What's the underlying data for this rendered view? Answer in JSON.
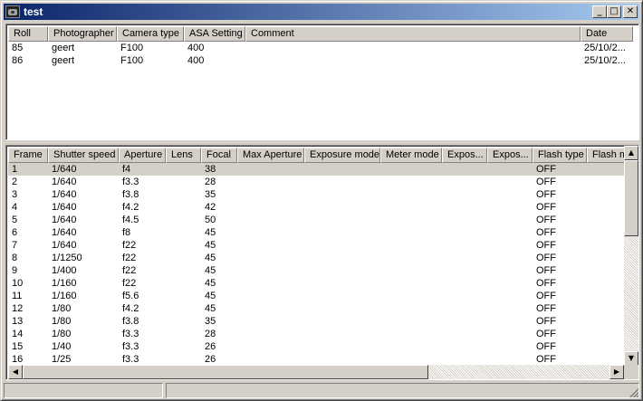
{
  "window": {
    "title": "test"
  },
  "rolls": {
    "columns": [
      "Roll",
      "Photographer",
      "Camera type",
      "ASA Setting",
      "Comment",
      "Date"
    ],
    "rows": [
      [
        "85",
        "geert",
        "F100",
        "400",
        "",
        "25/10/2..."
      ],
      [
        "86",
        "geert",
        "F100",
        "400",
        "",
        "25/10/2..."
      ]
    ]
  },
  "frames": {
    "columns": [
      "Frame",
      "Shutter speed",
      "Aperture",
      "Lens",
      "Focal",
      "Max Aperture",
      "Exposure mode",
      "Meter mode",
      "Expos...",
      "Expos...",
      "Flash type",
      "Flash m"
    ],
    "selected_row": 0,
    "rows": [
      [
        "1",
        "1/640",
        "f4",
        "",
        "38",
        "",
        "",
        "",
        "",
        "",
        "OFF",
        ""
      ],
      [
        "2",
        "1/640",
        "f3.3",
        "",
        "28",
        "",
        "",
        "",
        "",
        "",
        "OFF",
        ""
      ],
      [
        "3",
        "1/640",
        "f3.8",
        "",
        "35",
        "",
        "",
        "",
        "",
        "",
        "OFF",
        ""
      ],
      [
        "4",
        "1/640",
        "f4.2",
        "",
        "42",
        "",
        "",
        "",
        "",
        "",
        "OFF",
        ""
      ],
      [
        "5",
        "1/640",
        "f4.5",
        "",
        "50",
        "",
        "",
        "",
        "",
        "",
        "OFF",
        ""
      ],
      [
        "6",
        "1/640",
        "f8",
        "",
        "45",
        "",
        "",
        "",
        "",
        "",
        "OFF",
        ""
      ],
      [
        "7",
        "1/640",
        "f22",
        "",
        "45",
        "",
        "",
        "",
        "",
        "",
        "OFF",
        ""
      ],
      [
        "8",
        "1/1250",
        "f22",
        "",
        "45",
        "",
        "",
        "",
        "",
        "",
        "OFF",
        ""
      ],
      [
        "9",
        "1/400",
        "f22",
        "",
        "45",
        "",
        "",
        "",
        "",
        "",
        "OFF",
        ""
      ],
      [
        "10",
        "1/160",
        "f22",
        "",
        "45",
        "",
        "",
        "",
        "",
        "",
        "OFF",
        ""
      ],
      [
        "11",
        "1/160",
        "f5.6",
        "",
        "45",
        "",
        "",
        "",
        "",
        "",
        "OFF",
        ""
      ],
      [
        "12",
        "1/80",
        "f4.2",
        "",
        "45",
        "",
        "",
        "",
        "",
        "",
        "OFF",
        ""
      ],
      [
        "13",
        "1/80",
        "f3.8",
        "",
        "35",
        "",
        "",
        "",
        "",
        "",
        "OFF",
        ""
      ],
      [
        "14",
        "1/80",
        "f3.3",
        "",
        "28",
        "",
        "",
        "",
        "",
        "",
        "OFF",
        ""
      ],
      [
        "15",
        "1/40",
        "f3.3",
        "",
        "26",
        "",
        "",
        "",
        "",
        "",
        "OFF",
        ""
      ],
      [
        "16",
        "1/25",
        "f3.3",
        "",
        "26",
        "",
        "",
        "",
        "",
        "",
        "OFF",
        ""
      ]
    ]
  },
  "icons": {
    "app": "camera-icon",
    "minimize": "minimize-icon",
    "maximize": "maximize-icon",
    "close": "close-icon",
    "scroll_up": "arrow-up-icon",
    "scroll_down": "arrow-down-icon",
    "scroll_left": "arrow-left-icon",
    "scroll_right": "arrow-right-icon",
    "resize": "resize-grip-icon"
  },
  "colors": {
    "titlebar_start": "#0a246a",
    "titlebar_end": "#a6caf0",
    "face": "#d4d0c8",
    "selected_row": "#d4d0c8"
  }
}
